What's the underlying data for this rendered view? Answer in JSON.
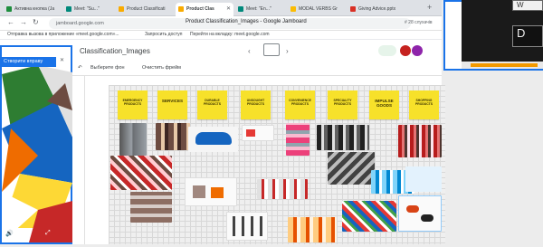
{
  "browser": {
    "tabs": [
      {
        "label": "Активна кнопка (Ja",
        "color": "#1e8e3e"
      },
      {
        "label": "Meet: \"Su...\"",
        "color": "#00897b"
      },
      {
        "label": "Product Classificati",
        "color": "#f9ab00"
      },
      {
        "label": "Product Clas",
        "color": "#f9ab00",
        "active": true
      },
      {
        "label": "Meet: \"En...\"",
        "color": "#00897b"
      },
      {
        "label": "MODAL VERBS Gr",
        "color": "#fbbc04"
      },
      {
        "label": "Giving Advice.pptx",
        "color": "#d93025"
      }
    ],
    "url": "jamboard.google.com",
    "page_title": "Product Classification_Images - Google Jamboard",
    "persons": "# 28 слухачів",
    "bookmarks": [
      "Отправка вызова в приложение «meet.google.com»...",
      "Запросить доступ",
      "Перейти на вкладку: meet.google.com"
    ]
  },
  "jamboard": {
    "title": "Classification_Images",
    "tools": {
      "select_bg": "Выберите фон",
      "clear_frame": "Очистить фрейм"
    },
    "stickies": [
      "EMERGENCY PRODUCTS",
      "SERVICES",
      "DURABLE PRODUCTS",
      "UNSOUGHT PRODUCTS",
      "CONVENIENCE PRODUCTS",
      "SPECIALITY PRODUCTS",
      "IMPULSE GOODS",
      "SHOPPING PRODUCTS"
    ]
  },
  "popup": {
    "button_label": "Створити вправу",
    "close": "×"
  },
  "video": {
    "letter_w": "W",
    "letter_d": "D"
  },
  "colors": {
    "accent": "#1a73e8",
    "sticky": "#f7e12a"
  }
}
